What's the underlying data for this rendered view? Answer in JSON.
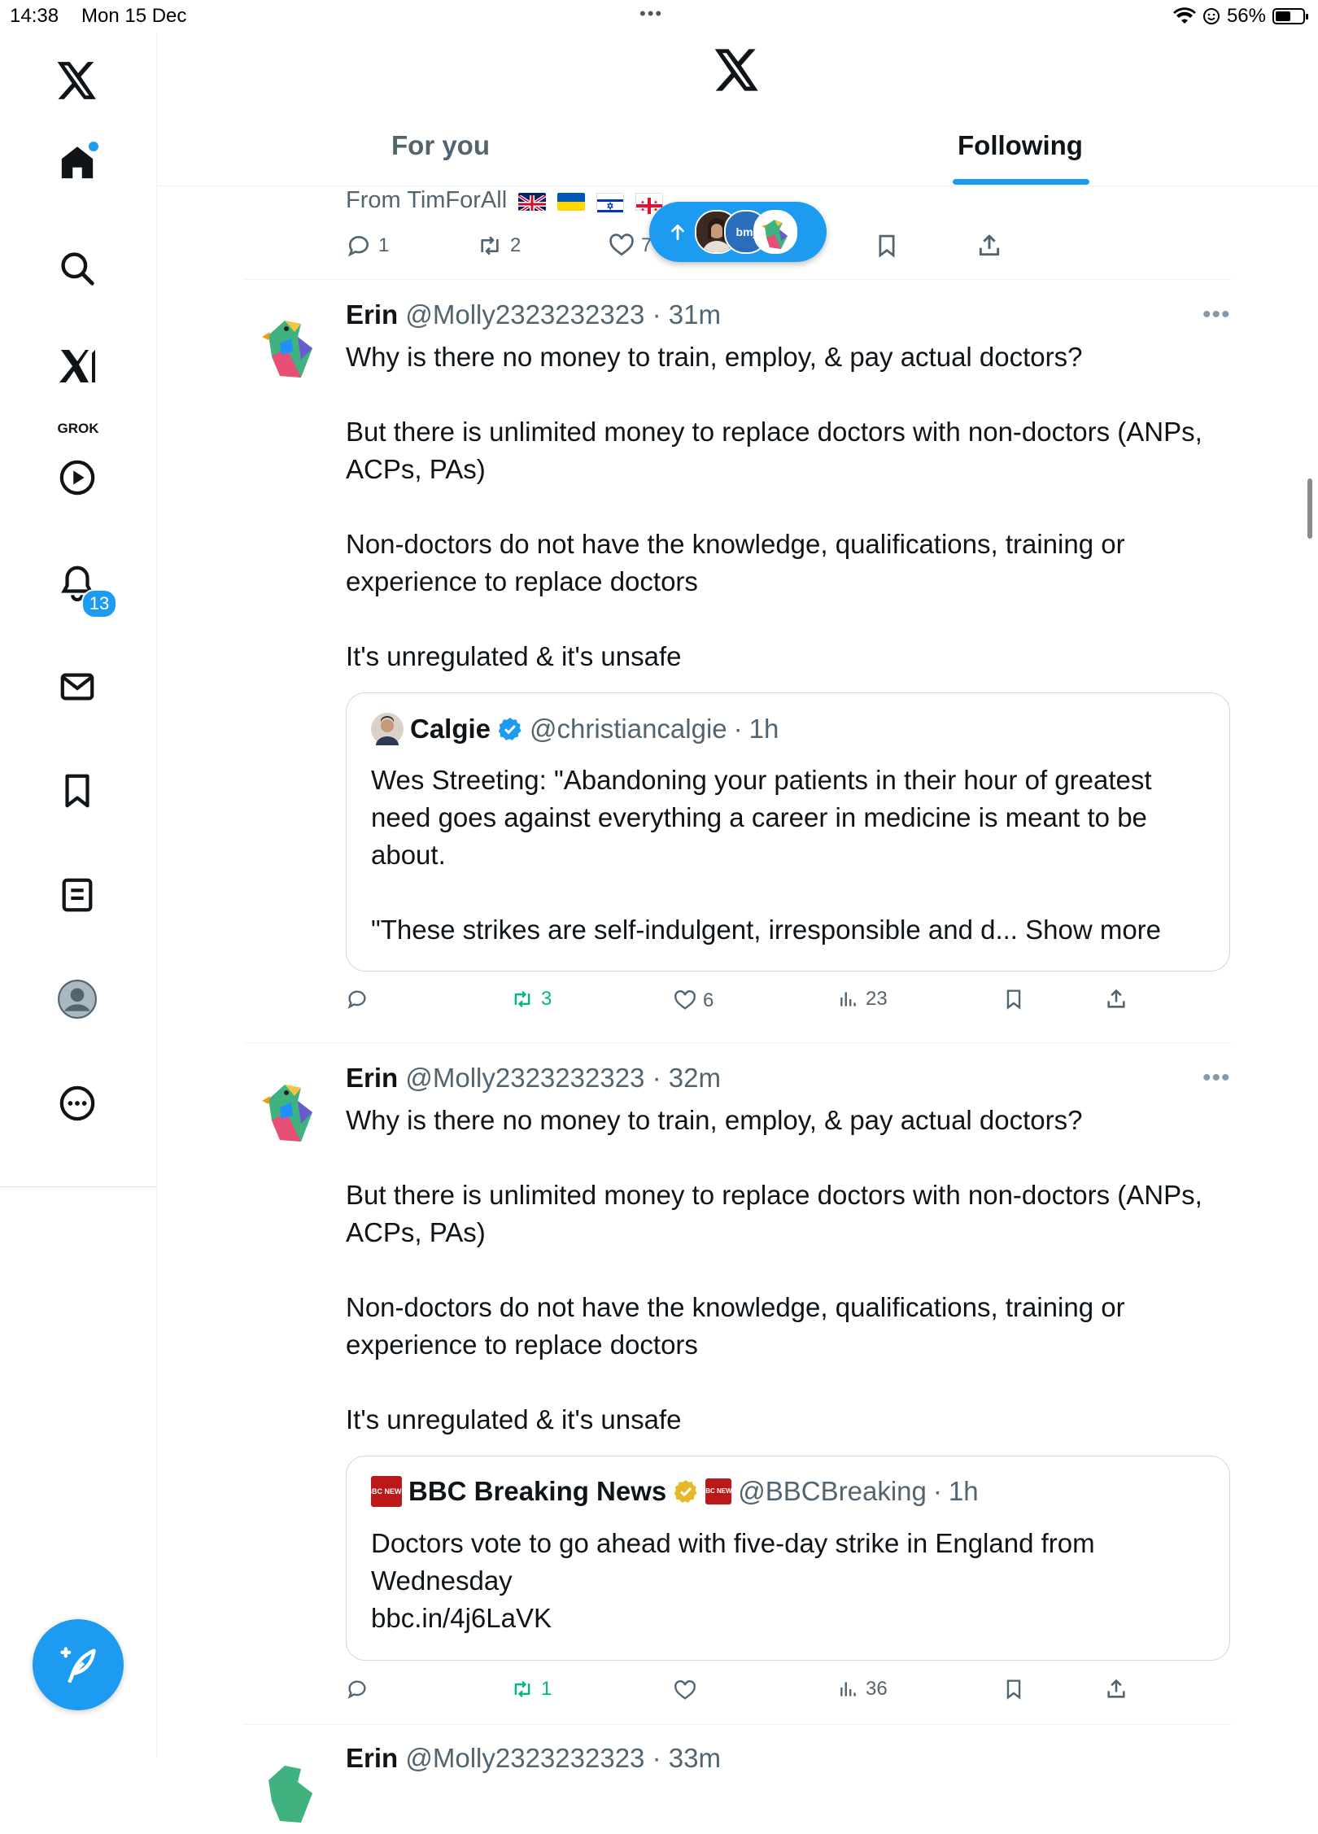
{
  "status_bar": {
    "time": "14:38",
    "date": "Mon 15 Dec",
    "battery": "56%",
    "battery_level": 0.56
  },
  "sidebar": {
    "grok_label": "GROK",
    "notifications_badge": "13"
  },
  "header": {
    "tabs": [
      {
        "label": "For you",
        "active": false
      },
      {
        "label": "Following",
        "active": true
      }
    ]
  },
  "new_posts_pill": {
    "bmj_label": "bmj"
  },
  "prev_tweet": {
    "from_line": "From TimForAll",
    "replies": "1",
    "reposts": "2",
    "likes": "7"
  },
  "tweets": [
    {
      "name": "Erin",
      "handle": "@Molly2323232323",
      "time": "31m",
      "paragraphs": [
        "Why is there no money to train, employ, & pay actual doctors?",
        "But there is unlimited money to replace doctors with non-doctors (ANPs, ACPs, PAs)",
        "Non-doctors do not have the knowledge, qualifications, training or experience to replace doctors",
        "It's unregulated & it's unsafe"
      ],
      "quote": {
        "name": "Calgie",
        "handle": "@christiancalgie",
        "time": "1h",
        "paragraphs": [
          "Wes Streeting: \"Abandoning your patients in their hour of greatest need goes against everything a career in medicine is meant to be about.",
          "\"These strikes are self-indulgent, irresponsible and d... Show more"
        ]
      },
      "reposts": "3",
      "likes": "6",
      "views": "23"
    },
    {
      "name": "Erin",
      "handle": "@Molly2323232323",
      "time": "32m",
      "paragraphs": [
        "Why is there no money to train, employ, & pay actual doctors?",
        "But there is unlimited money to replace doctors with non-doctors (ANPs, ACPs, PAs)",
        "Non-doctors do not have the knowledge, qualifications, training or experience to replace doctors",
        "It's unregulated & it's unsafe"
      ],
      "quote": {
        "name": "BBC Breaking News",
        "handle": "@BBCBreaking",
        "time": "1h",
        "paragraphs": [
          "Doctors vote to go ahead with five-day strike in England from Wednesday",
          "bbc.in/4j6LaVK"
        ],
        "logo_text": "BBC NEWS"
      },
      "reposts": "1",
      "likes": "",
      "views": "36"
    }
  ],
  "next_tweet": {
    "name_partial": "Erin",
    "handle_partial": "@Molly2323232323",
    "time_partial": "33m"
  },
  "colors": {
    "accent": "#1d9bf0",
    "repost_green": "#00ba7c",
    "muted": "#536471",
    "bbc_red": "#bb1919",
    "verified_gold": "#e8b829"
  }
}
